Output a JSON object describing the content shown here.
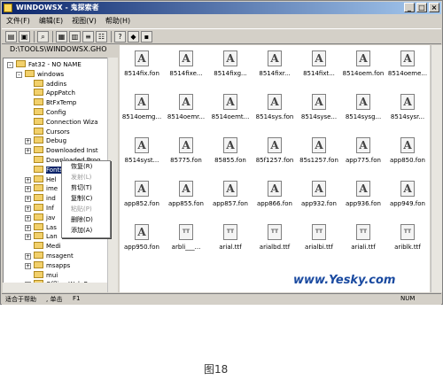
{
  "window": {
    "title": "WINDOWSX - 鬼探索者"
  },
  "menu": [
    "文件(F)",
    "编辑(E)",
    "视图(V)",
    "帮助(H)"
  ],
  "address": "D:\\TOOLS\\WINDOWSX.GHO",
  "tree": [
    {
      "label": "Fat32 - NO NAME",
      "expander": "-"
    },
    {
      "label": "windows",
      "expander": "-"
    },
    {
      "label": "addins",
      "expander": ""
    },
    {
      "label": "AppPatch",
      "expander": ""
    },
    {
      "label": "BtFxTemp",
      "expander": ""
    },
    {
      "label": "Config",
      "expander": ""
    },
    {
      "label": "Connection Wiza",
      "expander": ""
    },
    {
      "label": "Cursors",
      "expander": ""
    },
    {
      "label": "Debug",
      "expander": "+"
    },
    {
      "label": "Downloaded Inst",
      "expander": "+"
    },
    {
      "label": "Downloaded Prog",
      "expander": ""
    },
    {
      "label": "Fonts",
      "expander": "",
      "selected": true
    },
    {
      "label": "Hel",
      "expander": "+"
    },
    {
      "label": "ime",
      "expander": "+"
    },
    {
      "label": "ind",
      "expander": "+"
    },
    {
      "label": "Inf",
      "expander": "+"
    },
    {
      "label": "jav",
      "expander": "+"
    },
    {
      "label": "Las",
      "expander": "+"
    },
    {
      "label": "Lan",
      "expander": "+"
    },
    {
      "label": "Medi",
      "expander": ""
    },
    {
      "label": "msagent",
      "expander": "+"
    },
    {
      "label": "msapps",
      "expander": "+"
    },
    {
      "label": "mui",
      "expander": ""
    },
    {
      "label": "Offline Web Pag",
      "expander": "+"
    }
  ],
  "context_menu": [
    {
      "label": "恢复(R)",
      "disabled": false
    },
    {
      "label": "发射(L)",
      "disabled": true
    },
    {
      "label": "剪切(T)",
      "disabled": false
    },
    {
      "label": "复制(C)",
      "disabled": false
    },
    {
      "label": "粘贴(P)",
      "disabled": true
    },
    {
      "label": "删除(D)",
      "disabled": false
    },
    {
      "label": "添加(A)",
      "disabled": false
    }
  ],
  "files": [
    {
      "name": "8514fix.fon",
      "type": "fon"
    },
    {
      "name": "8514fixe...",
      "type": "fon"
    },
    {
      "name": "8514fixg...",
      "type": "fon"
    },
    {
      "name": "8514fixr...",
      "type": "fon"
    },
    {
      "name": "8514fixt...",
      "type": "fon"
    },
    {
      "name": "8514oem.fon",
      "type": "fon"
    },
    {
      "name": "8514oeme...",
      "type": "fon"
    },
    {
      "name": "8514oemg...",
      "type": "fon"
    },
    {
      "name": "8514oemr...",
      "type": "fon"
    },
    {
      "name": "8514oemt...",
      "type": "fon"
    },
    {
      "name": "8514sys.fon",
      "type": "fon"
    },
    {
      "name": "8514syse...",
      "type": "fon"
    },
    {
      "name": "8514sysg...",
      "type": "fon"
    },
    {
      "name": "8514sysr...",
      "type": "fon"
    },
    {
      "name": "8514syst...",
      "type": "fon"
    },
    {
      "name": "85775.fon",
      "type": "fon"
    },
    {
      "name": "85855.fon",
      "type": "fon"
    },
    {
      "name": "85f1257.fon",
      "type": "fon"
    },
    {
      "name": "85s1257.fon",
      "type": "fon"
    },
    {
      "name": "app775.fon",
      "type": "fon"
    },
    {
      "name": "app850.fon",
      "type": "fon"
    },
    {
      "name": "app852.fon",
      "type": "fon"
    },
    {
      "name": "app855.fon",
      "type": "fon"
    },
    {
      "name": "app857.fon",
      "type": "fon"
    },
    {
      "name": "app866.fon",
      "type": "fon"
    },
    {
      "name": "app932.fon",
      "type": "fon"
    },
    {
      "name": "app936.fon",
      "type": "fon"
    },
    {
      "name": "app949.fon",
      "type": "fon"
    },
    {
      "name": "app950.fon",
      "type": "fon"
    },
    {
      "name": "arbli___...",
      "type": "ttf"
    },
    {
      "name": "arial.ttf",
      "type": "ttf"
    },
    {
      "name": "arialbd.ttf",
      "type": "ttf"
    },
    {
      "name": "arialbi.ttf",
      "type": "ttf"
    },
    {
      "name": "ariali.ttf",
      "type": "ttf"
    },
    {
      "name": "ariblk.ttf",
      "type": "ttf"
    }
  ],
  "status": {
    "left": "适合于帮助",
    "middle": ", 单击",
    "key": "F1",
    "right": "NUM"
  },
  "watermark": "www.Yesky.com",
  "caption": "图18"
}
